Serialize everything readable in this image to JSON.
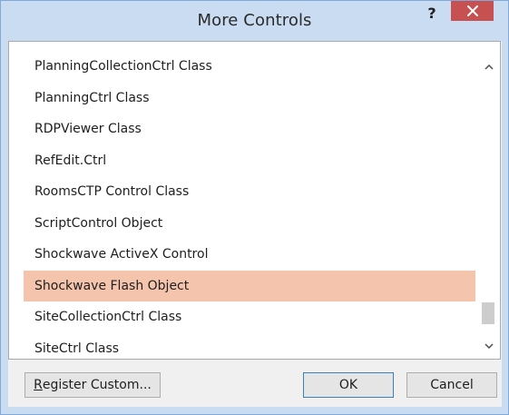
{
  "window": {
    "title": "More Controls",
    "help_glyph": "?",
    "close_glyph": "×"
  },
  "list": {
    "items": [
      {
        "label": "PlanningCollectionCtrl Class",
        "selected": false
      },
      {
        "label": "PlanningCtrl Class",
        "selected": false
      },
      {
        "label": "RDPViewer Class",
        "selected": false
      },
      {
        "label": "RefEdit.Ctrl",
        "selected": false
      },
      {
        "label": "RoomsCTP Control Class",
        "selected": false
      },
      {
        "label": "ScriptControl Object",
        "selected": false
      },
      {
        "label": "Shockwave ActiveX Control",
        "selected": false
      },
      {
        "label": "Shockwave Flash Object",
        "selected": true
      },
      {
        "label": "SiteCollectionCtrl Class",
        "selected": false
      },
      {
        "label": "SiteCtrl Class",
        "selected": false
      }
    ]
  },
  "buttons": {
    "register_custom_mnemonic": "R",
    "register_custom_rest": "egister Custom...",
    "ok": "OK",
    "cancel": "Cancel"
  },
  "colors": {
    "frame": "#c9dcf1",
    "selection": "#f4c4ad",
    "close": "#c75050"
  },
  "icons": {
    "help": "help-icon",
    "close": "close-icon",
    "scroll_up": "chevron-up-icon",
    "scroll_down": "chevron-down-icon"
  }
}
